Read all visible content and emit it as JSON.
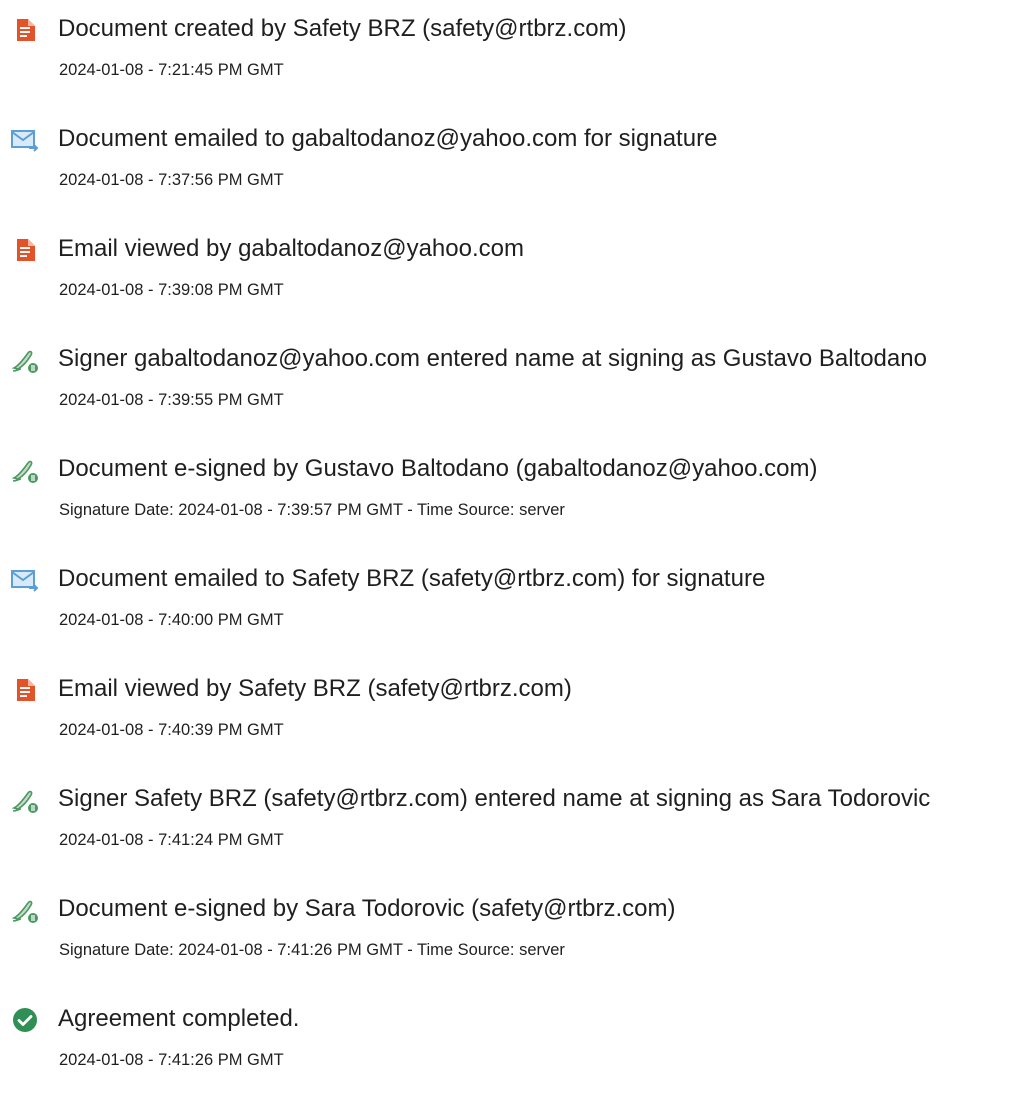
{
  "colors": {
    "document_icon": "#e3532a",
    "email_icon": "#5b9fd6",
    "sign_icon": "#4a9860",
    "complete_icon": "#2f8f55",
    "text": "#1f1f1f"
  },
  "events": [
    {
      "icon": "document-icon",
      "title": "Document created by Safety BRZ (safety@rtbrz.com)",
      "time": "2024-01-08 - 7:21:45 PM GMT"
    },
    {
      "icon": "email-icon",
      "title": "Document emailed to gabaltodanoz@yahoo.com for signature",
      "time": "2024-01-08 - 7:37:56 PM GMT"
    },
    {
      "icon": "document-icon",
      "title": "Email viewed by gabaltodanoz@yahoo.com",
      "time": "2024-01-08 - 7:39:08 PM GMT"
    },
    {
      "icon": "sign-icon",
      "title": "Signer gabaltodanoz@yahoo.com entered name at signing as Gustavo Baltodano",
      "time": "2024-01-08 - 7:39:55 PM GMT"
    },
    {
      "icon": "sign-icon",
      "title": "Document e-signed by Gustavo Baltodano (gabaltodanoz@yahoo.com)",
      "time": "Signature Date: 2024-01-08 - 7:39:57 PM GMT - Time Source: server"
    },
    {
      "icon": "email-icon",
      "title": "Document emailed to Safety BRZ (safety@rtbrz.com) for signature",
      "time": "2024-01-08 - 7:40:00 PM GMT"
    },
    {
      "icon": "document-icon",
      "title": "Email viewed by Safety BRZ (safety@rtbrz.com)",
      "time": "2024-01-08 - 7:40:39 PM GMT"
    },
    {
      "icon": "sign-icon",
      "title": "Signer Safety BRZ (safety@rtbrz.com) entered name at signing as Sara Todorovic",
      "time": "2024-01-08 - 7:41:24 PM GMT"
    },
    {
      "icon": "sign-icon",
      "title": "Document e-signed by Sara Todorovic (safety@rtbrz.com)",
      "time": "Signature Date: 2024-01-08 - 7:41:26 PM GMT - Time Source: server"
    },
    {
      "icon": "checkmark-icon",
      "title": "Agreement completed.",
      "time": "2024-01-08 - 7:41:26 PM GMT"
    }
  ]
}
